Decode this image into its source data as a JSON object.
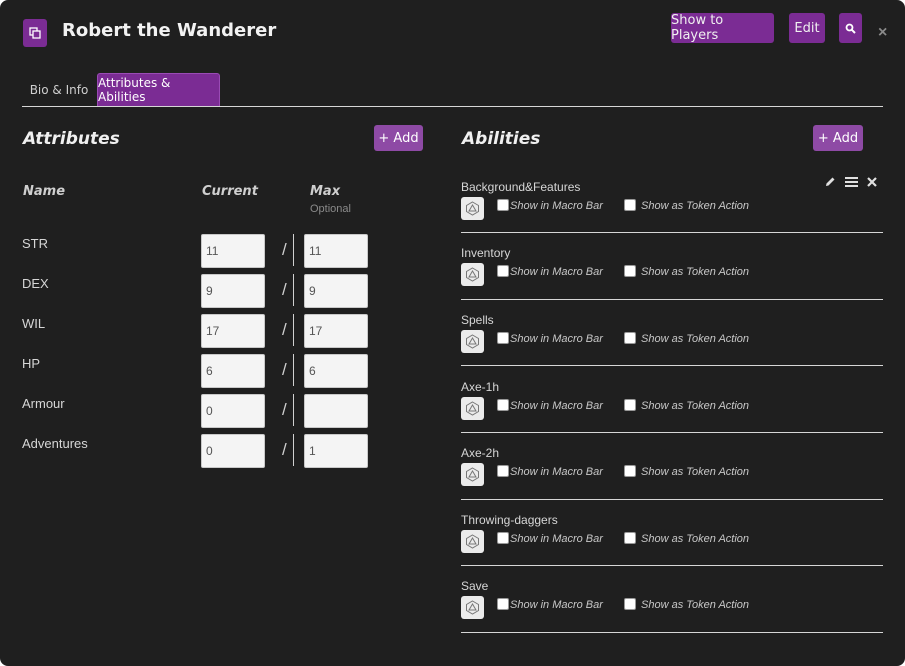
{
  "header": {
    "title": "Robert the Wanderer",
    "show_to_players": "Show to Players",
    "edit": "Edit",
    "close": "×"
  },
  "tabs": [
    {
      "label": "Bio & Info",
      "active": false
    },
    {
      "label": "Attributes & Abilities",
      "active": true
    }
  ],
  "attributes": {
    "title": "Attributes",
    "add_label": "+ Add",
    "col_name": "Name",
    "col_current": "Current",
    "col_max": "Max",
    "col_max_sub": "Optional",
    "separator": "/",
    "rows": [
      {
        "name": "STR",
        "current": "11",
        "max": "11"
      },
      {
        "name": "DEX",
        "current": "9",
        "max": "9"
      },
      {
        "name": "WIL",
        "current": "17",
        "max": "17"
      },
      {
        "name": "HP",
        "current": "6",
        "max": "6"
      },
      {
        "name": "Armour",
        "current": "0",
        "max": ""
      },
      {
        "name": "Adventures",
        "current": "0",
        "max": "1"
      }
    ]
  },
  "abilities": {
    "title": "Abilities",
    "add_label": "+ Add",
    "macro_label": "Show in Macro Bar",
    "token_label": "Show as Token Action",
    "items": [
      {
        "name": "Background&Features"
      },
      {
        "name": "Inventory"
      },
      {
        "name": "Spells"
      },
      {
        "name": "Axe-1h"
      },
      {
        "name": "Axe-2h"
      },
      {
        "name": "Throwing-daggers"
      },
      {
        "name": "Save"
      }
    ]
  },
  "colors": {
    "accent": "#7b2c94",
    "add_button": "#8e4aa5",
    "background": "#1f1f1f"
  }
}
